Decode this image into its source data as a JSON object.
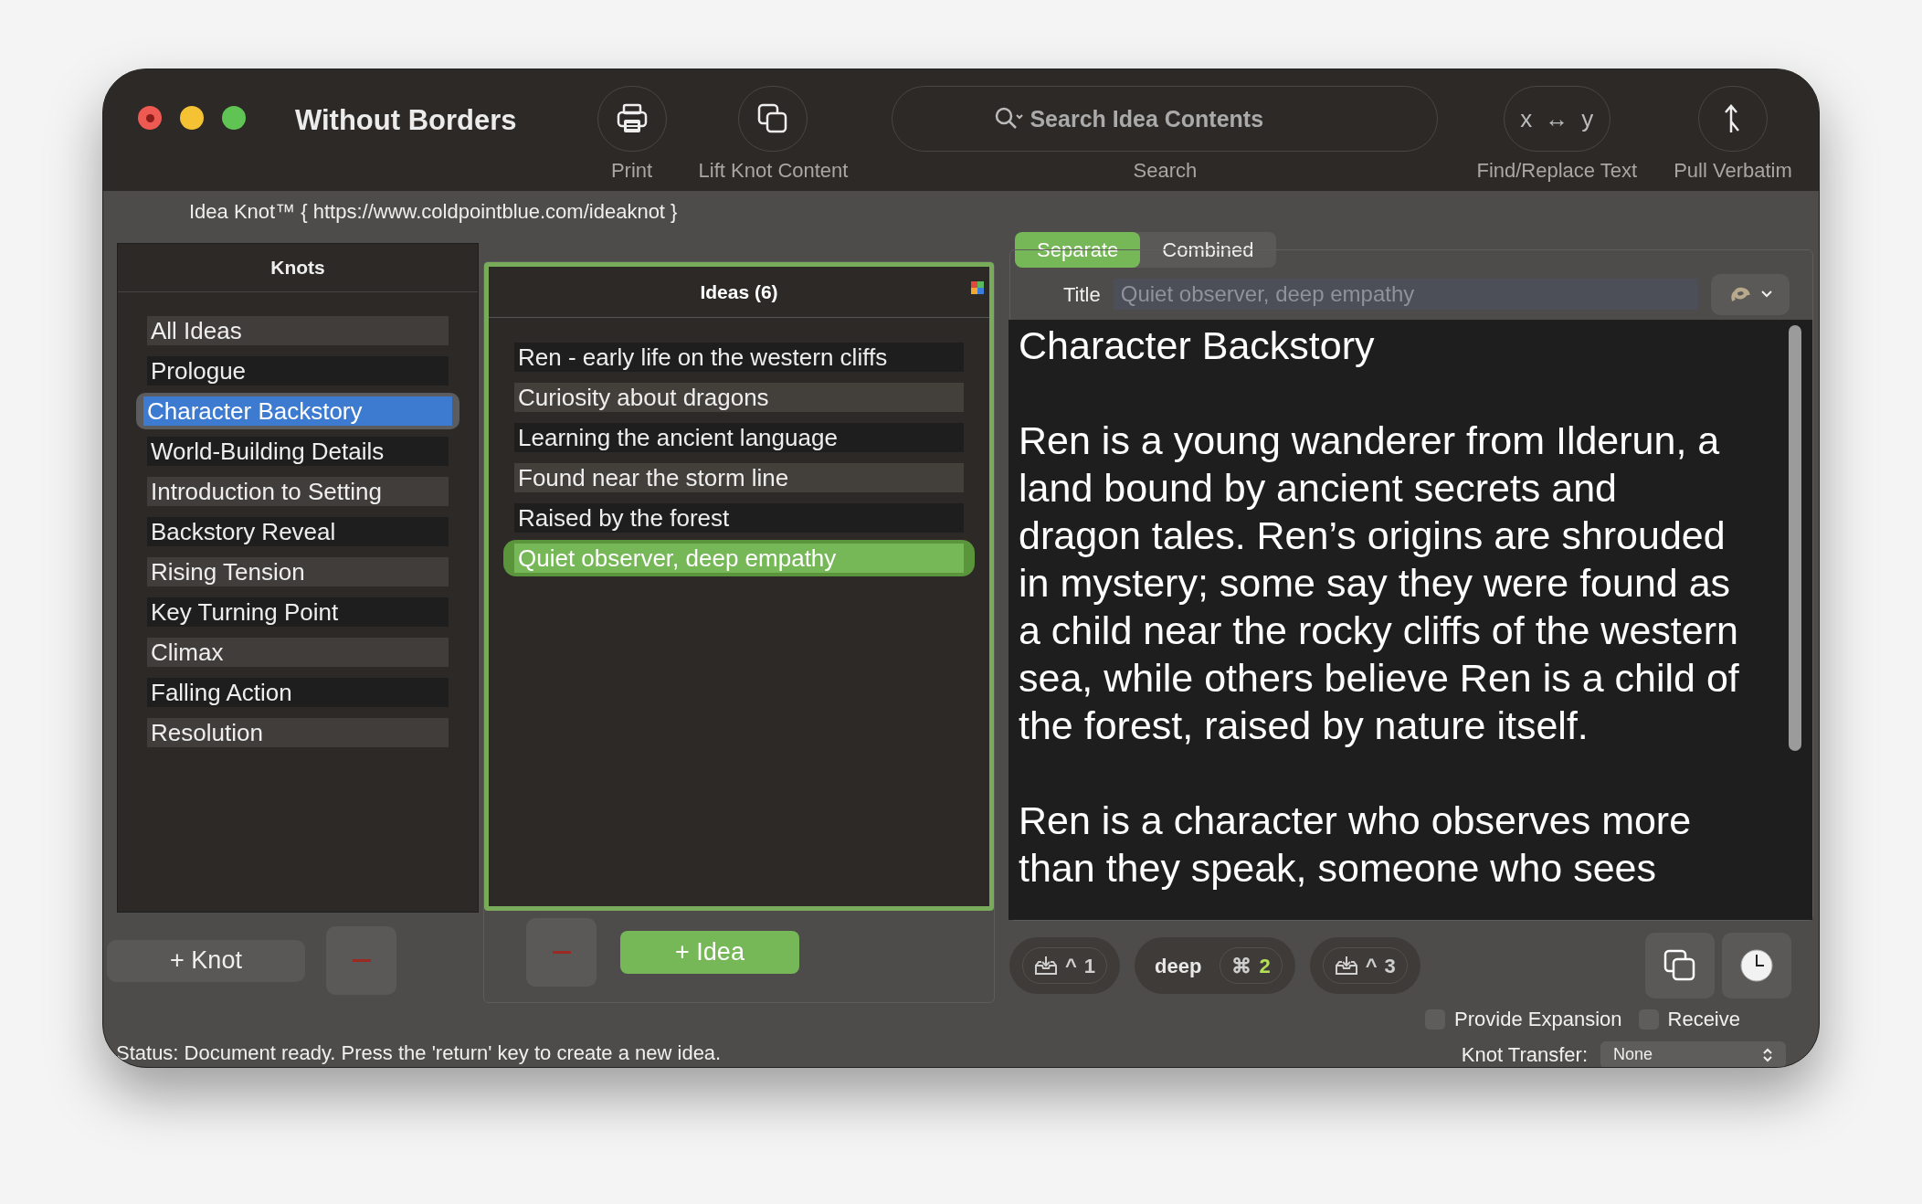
{
  "window": {
    "title": "Without Borders"
  },
  "toolbar": [
    {
      "kind": "print",
      "label": "Print"
    },
    {
      "kind": "lift",
      "label": "Lift Knot Content"
    },
    {
      "kind": "search",
      "label": "Search",
      "placeholder": "Search Idea Contents"
    },
    {
      "kind": "swap",
      "label": "Find/Replace Text",
      "left": "x",
      "arrow": "↔",
      "right": "y"
    },
    {
      "kind": "pull",
      "label": "Pull Verbatim"
    }
  ],
  "banner": "Idea Knot™ { https://www.coldpointblue.com/ideaknot }",
  "knots": {
    "header": "Knots",
    "items": [
      {
        "label": "All Ideas",
        "selected": false
      },
      {
        "label": "Prologue",
        "selected": false
      },
      {
        "label": "Character Backstory",
        "selected": true
      },
      {
        "label": "World-Building Details",
        "selected": false
      },
      {
        "label": "Introduction to Setting",
        "selected": false
      },
      {
        "label": "Backstory Reveal",
        "selected": false
      },
      {
        "label": "Rising Tension",
        "selected": false
      },
      {
        "label": "Key Turning Point",
        "selected": false
      },
      {
        "label": "Climax",
        "selected": false
      },
      {
        "label": "Falling Action",
        "selected": false
      },
      {
        "label": "Resolution",
        "selected": false
      }
    ],
    "add_button": "+ Knot"
  },
  "ideas": {
    "header": "Ideas (6)",
    "items": [
      {
        "label": "Ren - early life on the western cliffs",
        "selected": false
      },
      {
        "label": "Curiosity about dragons",
        "selected": false
      },
      {
        "label": "Learning the ancient language",
        "selected": false
      },
      {
        "label": "Found near the storm line",
        "selected": false
      },
      {
        "label": "Raised by the forest",
        "selected": false
      },
      {
        "label": "Quiet observer, deep empathy",
        "selected": true
      }
    ],
    "add_button": "+ Idea"
  },
  "editor": {
    "tabs": [
      {
        "label": "Separate",
        "selected": true
      },
      {
        "label": "Combined",
        "selected": false
      }
    ],
    "title_label": "Title",
    "title_placeholder": "Quiet observer, deep empathy",
    "paragraphs": [
      "Character Backstory",
      "Ren is a young wanderer from Ilderun, a land bound by ancient secrets and dragon tales. Ren’s origins are shrouded in mystery; some say they were found as a child near the rocky cliffs of the western sea, while others believe Ren is a child of the forest, raised by nature itself.",
      "Ren is a character who observes more than they speak, someone who sees"
    ],
    "shortcuts": [
      {
        "kind": "inbox",
        "modifier": "^",
        "number": "1",
        "active": false
      },
      {
        "kind": "word",
        "word": "deep",
        "modifier": "⌘",
        "number": "2",
        "active": true
      },
      {
        "kind": "inbox",
        "modifier": "^",
        "number": "3",
        "active": false
      }
    ]
  },
  "options": [
    {
      "label": "Provide Expansion",
      "checked": false
    },
    {
      "label": "Receive",
      "checked": false
    }
  ],
  "knot_transfer": {
    "label": "Knot Transfer:",
    "value": "None"
  },
  "status_bar": "Status: Document ready. Press the 'return' key to create a new idea."
}
